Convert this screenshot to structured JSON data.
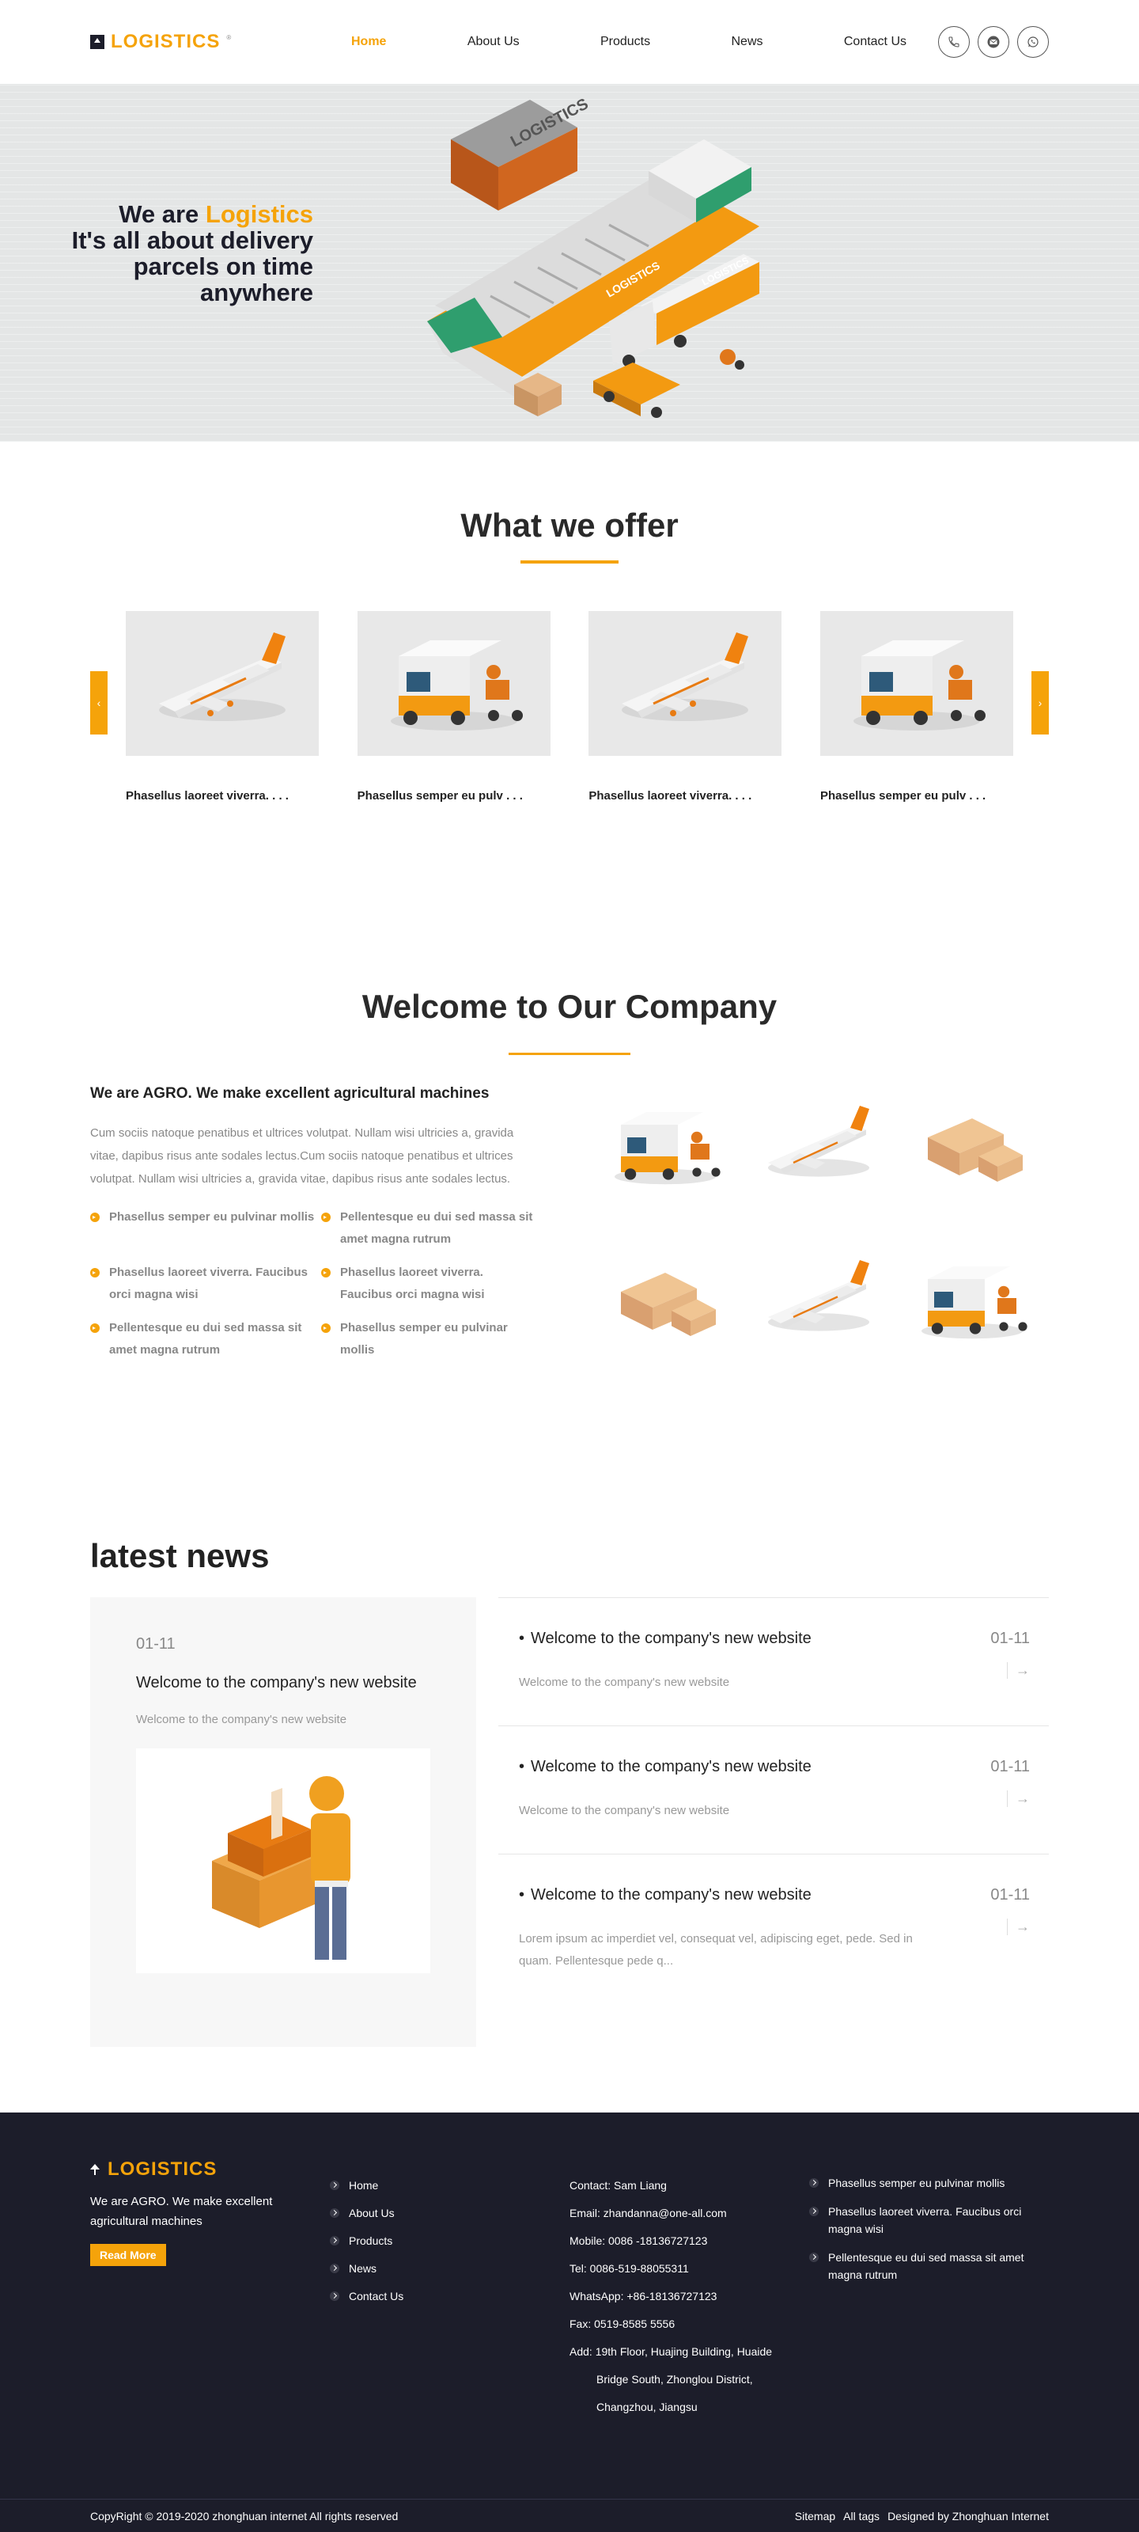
{
  "brand": {
    "name": "LOGISTICS",
    "sup": "®"
  },
  "nav": {
    "items": [
      {
        "label": "Home"
      },
      {
        "label": "About Us"
      },
      {
        "label": "Products"
      },
      {
        "label": "News"
      },
      {
        "label": "Contact Us"
      }
    ],
    "active": "Home",
    "contact_icons": [
      "phone-icon",
      "mail-icon",
      "whatsapp-icon"
    ]
  },
  "hero": {
    "line1_prefix": "We are ",
    "line1_accent": "Logistics",
    "line2": "It's all about delivery",
    "line3": "parcels on time",
    "line4": "anywhere",
    "art_labels": {
      "container": "LOGISTICS",
      "ship": "LOGISTICS",
      "truck": "LOGISTICS"
    }
  },
  "offer": {
    "title": "What we offer",
    "cards": [
      {
        "caption": "Phasellus laoreet viverra. . . .",
        "icon": "airplane-illustration"
      },
      {
        "caption": "Phasellus semper eu pulv . . .",
        "icon": "delivery-vehicle-illustration"
      },
      {
        "caption": "Phasellus laoreet viverra. . . .",
        "icon": "airplane-illustration"
      },
      {
        "caption": "Phasellus semper eu pulv . . .",
        "icon": "delivery-vehicle-illustration"
      }
    ],
    "prev_label": "‹",
    "next_label": "›"
  },
  "welcome": {
    "title": "Welcome to Our Company",
    "subtitle": "We are AGRO. We make excellent agricultural machines",
    "paragraph": "Cum sociis natoque penatibus et ultrices volutpat. Nullam wisi ultricies a, gravida vitae, dapibus risus ante sodales lectus.Cum sociis natoque penatibus et ultrices volutpat. Nullam wisi ultricies a, gravida vitae, dapibus risus ante sodales lectus.",
    "features": [
      "Phasellus semper eu pulvinar mollis",
      "Pellentesque eu dui sed massa sit amet magna rutrum",
      "Phasellus laoreet viverra. Faucibus orci magna wisi",
      "Phasellus laoreet viverra. Faucibus orci magna wisi",
      "Pellentesque eu dui sed massa sit amet magna rutrum",
      "Phasellus semper eu pulvinar mollis"
    ],
    "tiles": [
      "delivery-vehicle-illustration",
      "airplane-illustration",
      "boxes-illustration",
      "boxes-illustration",
      "airplane-illustration",
      "delivery-vehicle-illustration"
    ]
  },
  "news": {
    "heading": "latest news",
    "featured": {
      "date": "01-11",
      "title": "Welcome to the company's new website",
      "summary": "Welcome to the company's new website",
      "image": "courier-with-boxes-illustration"
    },
    "items": [
      {
        "title": "Welcome to the company's new website",
        "summary": "Welcome to the company's new website",
        "date": "01-11",
        "arrow": "→"
      },
      {
        "title": "Welcome to the company's new website",
        "summary": "Welcome to the company's new website",
        "date": "01-11",
        "arrow": "→"
      },
      {
        "title": "Welcome to the company's new website",
        "summary": "Lorem ipsum ac imperdiet vel, consequat vel, adipiscing eget, pede. Sed in quam. Pellentesque pede q...",
        "date": "01-11",
        "arrow": "→"
      }
    ]
  },
  "footer": {
    "brand": "LOGISTICS",
    "slogan": "We are AGRO. We make excellent agricultural machines",
    "button": "Read More",
    "links": [
      "Home",
      "About Us",
      "Products",
      "News",
      "Contact Us"
    ],
    "contact": {
      "contact": "Contact: Sam Liang",
      "email": "Email: zhandanna@one-all.com",
      "mobile": "Mobile: 0086 -18136727123",
      "tel": "Tel: 0086-519-88055311",
      "whatsapp": "WhatsApp: +86-18136727123",
      "fax": "Fax: 0519-8585 5556",
      "address1": "Add: 19th Floor, Huajing Building, Huaide",
      "address2": "Bridge South, Zhonglou District,",
      "address3": "Changzhou, Jiangsu"
    },
    "news": [
      "Phasellus semper eu pulvinar mollis",
      "Phasellus laoreet viverra. Faucibus orci magna wisi",
      "Pellentesque eu dui sed massa sit amet magna rutrum"
    ],
    "copyright": "CopyRight © 2019-2020   zhonghuan internet  All rights reserved",
    "bottom_links": [
      "Sitemap",
      "All tags",
      "Designed by Zhonghuan Internet"
    ]
  },
  "colors": {
    "accent": "#f5a30a",
    "dark": "#1c1d2a",
    "hero_bg": "#e4e6e6"
  }
}
